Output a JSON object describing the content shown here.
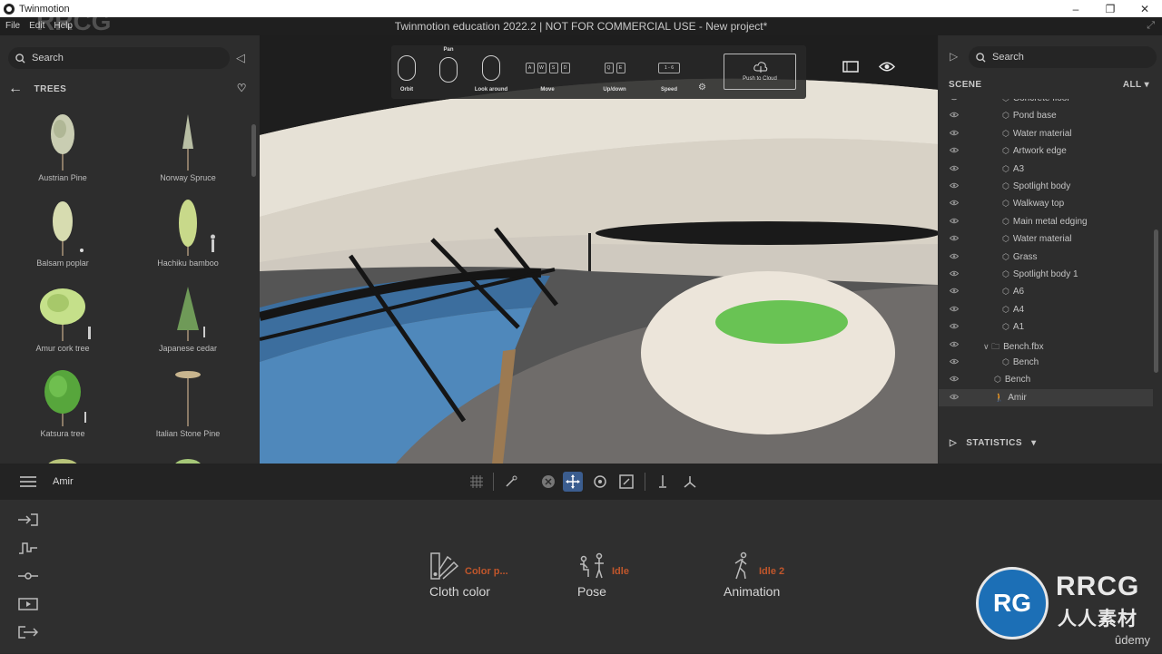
{
  "window": {
    "app_name": "Twinmotion",
    "title": "Twinmotion education 2022.2 | NOT FOR COMMERCIAL USE - New project*",
    "controls": [
      "–",
      "❐",
      "✕"
    ]
  },
  "menu": [
    "File",
    "Edit",
    "Help"
  ],
  "library": {
    "search_placeholder": "Search",
    "category": "TREES",
    "trees": [
      "Austrian Pine",
      "Norway Spruce",
      "Balsam poplar",
      "Hachiku bamboo",
      "Amur cork tree",
      "Japanese cedar",
      "Katsura tree",
      "Italian Stone Pine"
    ]
  },
  "navigation": {
    "orbit": "Orbit",
    "pan": "Pan",
    "look_around": "Look around",
    "move": "Move",
    "updown": "Up/down",
    "speed": "Speed",
    "push_cloud": "Push to Cloud",
    "keys_move": [
      "W",
      "A",
      "S",
      "D"
    ],
    "keys_updown": [
      "Q",
      "E"
    ],
    "speed_keys": "1 - 6"
  },
  "scene": {
    "search_placeholder": "Search",
    "header": "SCENE",
    "filter": "ALL",
    "items": [
      {
        "name": "Concrete floor",
        "type": "material"
      },
      {
        "name": "Pond base",
        "type": "material"
      },
      {
        "name": "Water material",
        "type": "material"
      },
      {
        "name": "Artwork edge",
        "type": "material"
      },
      {
        "name": "A3",
        "type": "material"
      },
      {
        "name": "Spotlight body",
        "type": "material"
      },
      {
        "name": "Walkway top",
        "type": "material"
      },
      {
        "name": "Main metal edging",
        "type": "material"
      },
      {
        "name": "Water material",
        "type": "material"
      },
      {
        "name": "Grass",
        "type": "material"
      },
      {
        "name": "Spotlight body 1",
        "type": "material"
      },
      {
        "name": "A6",
        "type": "material"
      },
      {
        "name": "A4",
        "type": "material"
      },
      {
        "name": "A1",
        "type": "material"
      },
      {
        "name": "Bench.fbx",
        "type": "folder"
      },
      {
        "name": "Bench",
        "type": "material"
      },
      {
        "name": "Bench",
        "type": "material"
      },
      {
        "name": "Amir",
        "type": "character"
      }
    ],
    "statistics": "STATISTICS"
  },
  "toolbar": {
    "selected_name": "Amir"
  },
  "properties": [
    {
      "value": "Color p...",
      "label": "Cloth color"
    },
    {
      "value": "Idle",
      "label": "Pose"
    },
    {
      "value": "Idle 2",
      "label": "Animation"
    }
  ],
  "branding": {
    "watermark": "RRCG",
    "logo_main": "RRCG",
    "logo_sub": "人人素材",
    "udemy": "ûdemy"
  },
  "colors": {
    "accent_active": "#3b5d8f",
    "property_value": "#c0562b",
    "grass": "#69c354"
  }
}
